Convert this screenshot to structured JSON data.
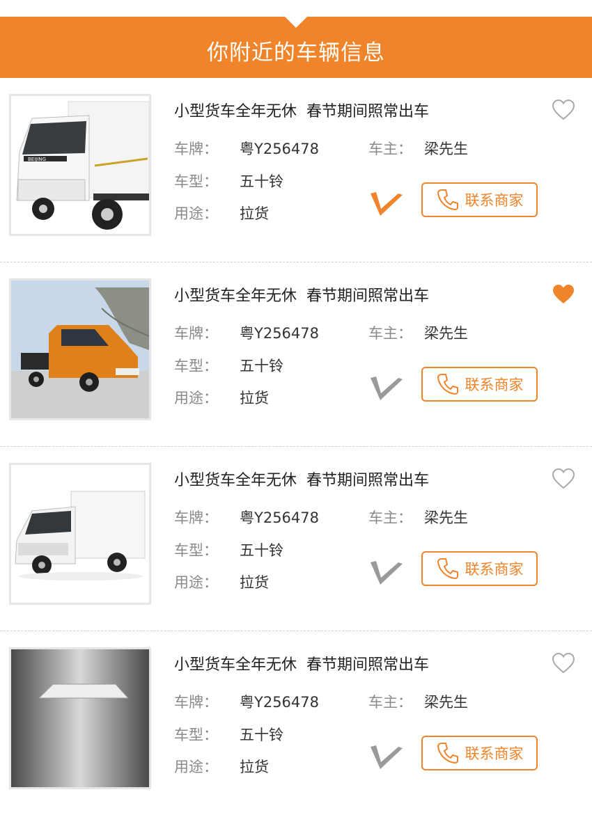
{
  "header": {
    "title": "你附近的车辆信息"
  },
  "colors": {
    "accent": "#f0842a",
    "muted_mark": "#9a9a9a"
  },
  "cards": [
    {
      "title": "小型货车全年无休  春节期间照常出车",
      "plate_label": "车牌：",
      "plate": "粤Y256478",
      "owner_label": "车主：",
      "owner": "梁先生",
      "model_label": "车型：",
      "model": "五十铃",
      "use_label": "用途：",
      "use": "拉货",
      "contact_label": "联系商家",
      "favorited": false,
      "verified_active": true,
      "image": "white-box-truck-photo"
    },
    {
      "title": "小型货车全年无休  春节期间照常出车",
      "plate_label": "车牌：",
      "plate": "粤Y256478",
      "owner_label": "车主：",
      "owner": "梁先生",
      "model_label": "车型：",
      "model": "五十铃",
      "use_label": "用途：",
      "use": "拉货",
      "contact_label": "联系商家",
      "favorited": true,
      "verified_active": false,
      "image": "orange-flatbed-van-photo"
    },
    {
      "title": "小型货车全年无休  春节期间照常出车",
      "plate_label": "车牌：",
      "plate": "粤Y256478",
      "owner_label": "车主：",
      "owner": "梁先生",
      "model_label": "车型：",
      "model": "五十铃",
      "use_label": "用途：",
      "use": "拉货",
      "contact_label": "联系商家",
      "favorited": false,
      "verified_active": false,
      "image": "white-box-truck-photo"
    },
    {
      "title": "小型货车全年无休  春节期间照常出车",
      "plate_label": "车牌：",
      "plate": "粤Y256478",
      "owner_label": "车主：",
      "owner": "梁先生",
      "model_label": "车型：",
      "model": "五十铃",
      "use_label": "用途：",
      "use": "拉货",
      "contact_label": "联系商家",
      "favorited": false,
      "verified_active": false,
      "image": "silver-truck-photo"
    }
  ]
}
